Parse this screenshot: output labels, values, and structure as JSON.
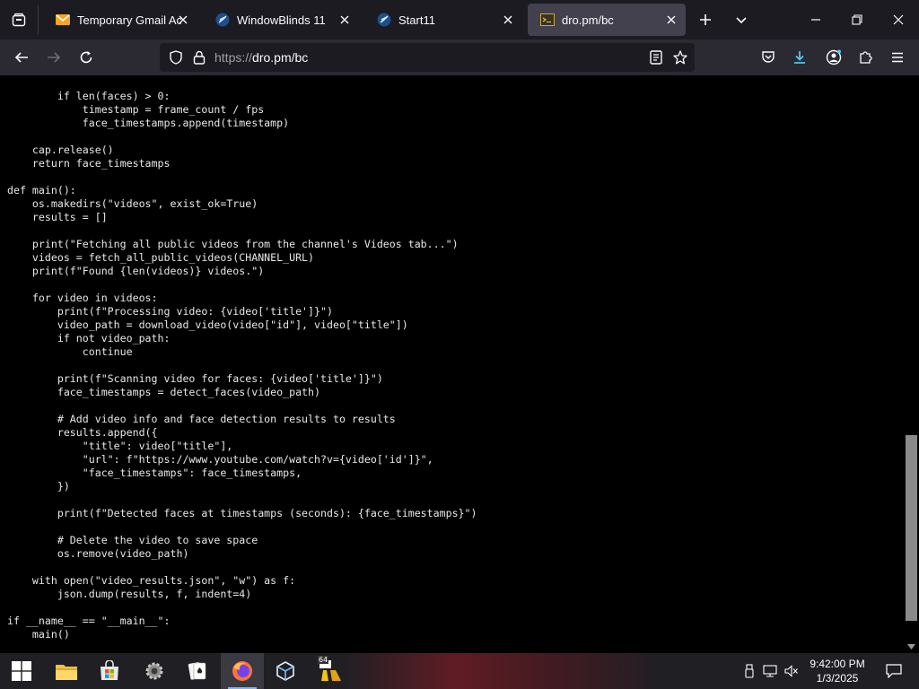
{
  "browser": {
    "tabs": [
      {
        "title": "Temporary Gmail Acco",
        "favicon": "gmail-envelope-icon",
        "active": false
      },
      {
        "title": "WindowBlinds 11",
        "favicon": "stardock-icon",
        "active": false
      },
      {
        "title": "Start11",
        "favicon": "stardock-icon",
        "active": false
      },
      {
        "title": "dro.pm/bc",
        "favicon": "terminal-icon",
        "active": true
      }
    ],
    "url": {
      "scheme": "https://",
      "host": "dro.pm/bc"
    }
  },
  "code": {
    "lines": [
      "        if len(faces) > 0:",
      "            timestamp = frame_count / fps",
      "            face_timestamps.append(timestamp)",
      "",
      "    cap.release()",
      "    return face_timestamps",
      "",
      "def main():",
      "    os.makedirs(\"videos\", exist_ok=True)",
      "    results = []",
      "",
      "    print(\"Fetching all public videos from the channel's Videos tab...\")",
      "    videos = fetch_all_public_videos(CHANNEL_URL)",
      "    print(f\"Found {len(videos)} videos.\")",
      "",
      "    for video in videos:",
      "        print(f\"Processing video: {video['title']}\")",
      "        video_path = download_video(video[\"id\"], video[\"title\"])",
      "        if not video_path:",
      "            continue",
      "",
      "        print(f\"Scanning video for faces: {video['title']}\")",
      "        face_timestamps = detect_faces(video_path)",
      "",
      "        # Add video info and face detection results to results",
      "        results.append({",
      "            \"title\": video[\"title\"],",
      "            \"url\": f\"https://www.youtube.com/watch?v={video['id']}\",",
      "            \"face_timestamps\": face_timestamps,",
      "        })",
      "",
      "        print(f\"Detected faces at timestamps (seconds): {face_timestamps}\")",
      "",
      "        # Delete the video to save space",
      "        os.remove(video_path)",
      "",
      "    with open(\"video_results.json\", \"w\") as f:",
      "        json.dump(results, f, indent=4)",
      "",
      "if __name__ == \"__main__\":",
      "    main()"
    ]
  },
  "scroll": {
    "position_fraction": 0.64,
    "visible_fraction": 0.33
  },
  "taskbar": {
    "apps": [
      {
        "name": "file-explorer-icon",
        "active": false
      },
      {
        "name": "microsoft-store-icon",
        "active": false
      },
      {
        "name": "settings-gear-icon",
        "active": false
      },
      {
        "name": "solitaire-icon",
        "active": false
      },
      {
        "name": "firefox-icon",
        "active": true
      },
      {
        "name": "virtualbox-icon",
        "active": false
      },
      {
        "name": "app-64-icon",
        "active": false,
        "badge": "64"
      }
    ],
    "time": "9:42:00 PM",
    "date": "1/3/2025"
  },
  "colors": {
    "accent": "#0078d4",
    "tab_active": "#42414d",
    "toolbar": "#2b2a33",
    "download_icon": "#59c8f0"
  }
}
